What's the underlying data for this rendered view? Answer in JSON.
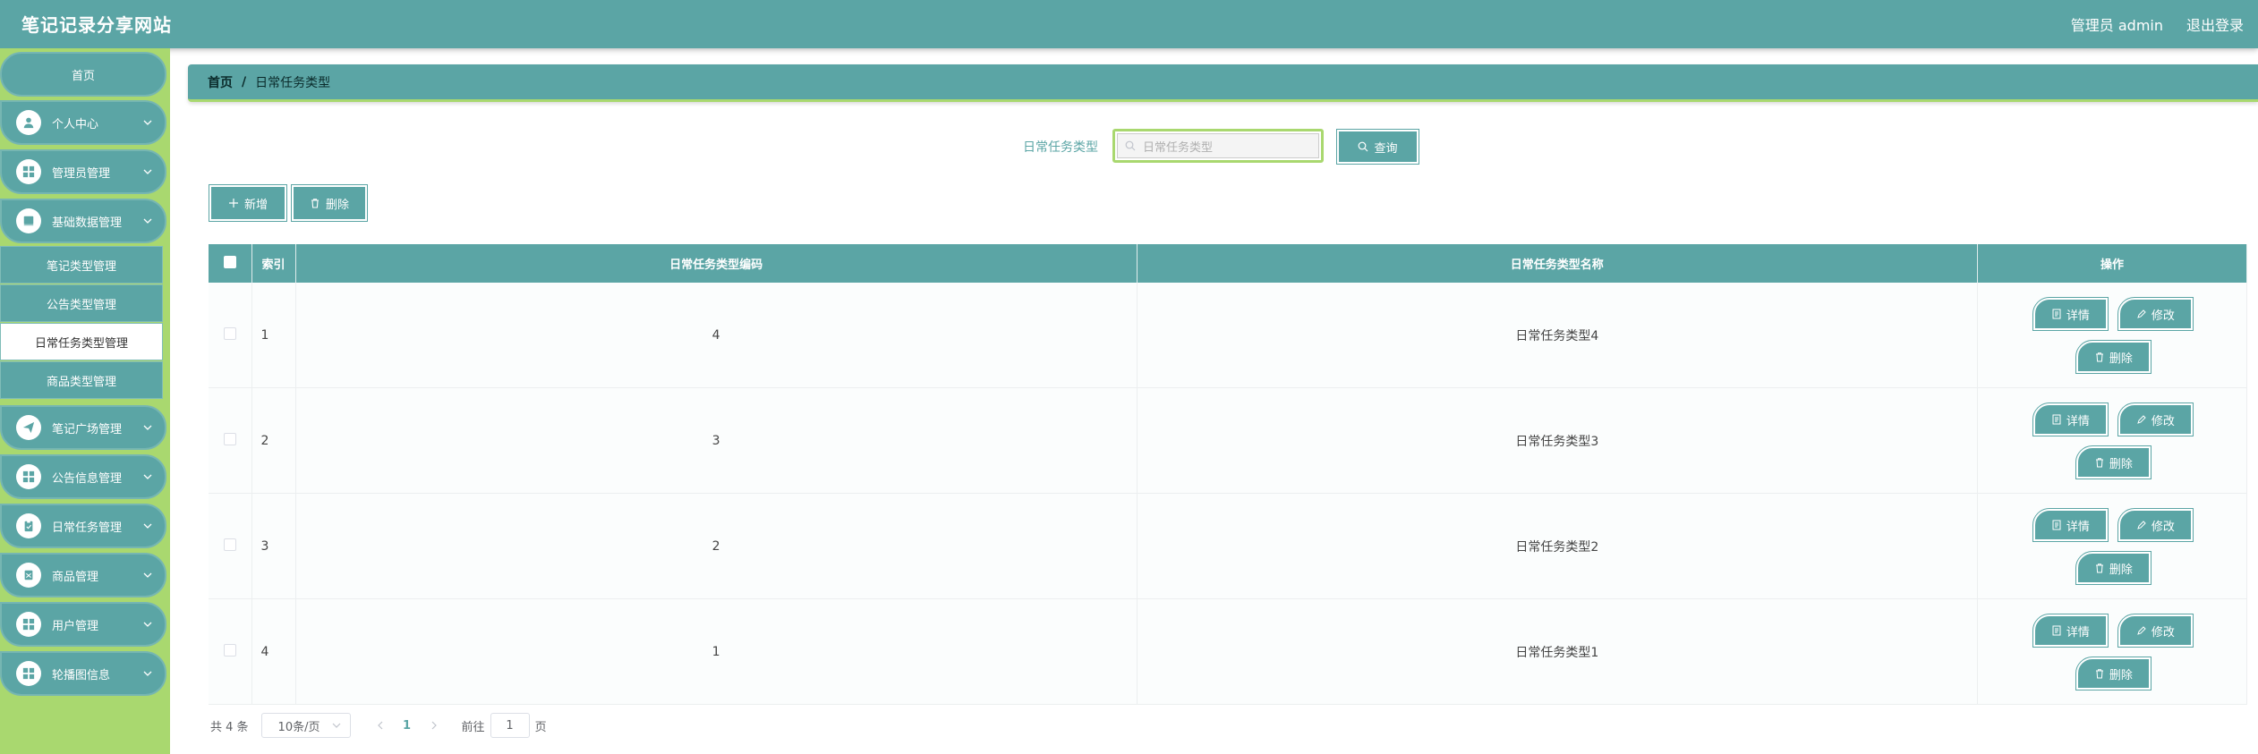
{
  "header": {
    "title": "笔记记录分享网站",
    "admin": "管理员 admin",
    "logout": "退出登录"
  },
  "sidebar": {
    "home": "首页",
    "items": [
      {
        "label": "个人中心",
        "icon": "user-icon"
      },
      {
        "label": "管理员管理",
        "icon": "grid-icon"
      },
      {
        "label": "基础数据管理",
        "icon": "book-icon"
      }
    ],
    "submenu": [
      {
        "label": "笔记类型管理"
      },
      {
        "label": "公告类型管理"
      },
      {
        "label": "日常任务类型管理"
      },
      {
        "label": "商品类型管理"
      }
    ],
    "items_after": [
      {
        "label": "笔记广场管理",
        "icon": "send-icon"
      },
      {
        "label": "公告信息管理",
        "icon": "grid-icon"
      },
      {
        "label": "日常任务管理",
        "icon": "clipboard-icon"
      },
      {
        "label": "商品管理",
        "icon": "tag-icon"
      },
      {
        "label": "用户管理",
        "icon": "grid-icon"
      },
      {
        "label": "轮播图信息",
        "icon": "grid-icon"
      }
    ]
  },
  "breadcrumb": {
    "home": "首页",
    "separator": "/",
    "current": "日常任务类型"
  },
  "search": {
    "label": "日常任务类型",
    "placeholder": "日常任务类型",
    "query_label": "查询"
  },
  "actions": {
    "add_label": "新增",
    "delete_label": "删除"
  },
  "table": {
    "headers": [
      "索引",
      "日常任务类型编码",
      "日常任务类型名称",
      "操作"
    ],
    "rows": [
      {
        "index": "1",
        "code": "4",
        "name": "日常任务类型4"
      },
      {
        "index": "2",
        "code": "3",
        "name": "日常任务类型3"
      },
      {
        "index": "3",
        "code": "2",
        "name": "日常任务类型2"
      },
      {
        "index": "4",
        "code": "1",
        "name": "日常任务类型1"
      }
    ],
    "op_detail": "详情",
    "op_edit": "修改",
    "op_delete": "删除"
  },
  "pagination": {
    "total": "共 4 条",
    "page_size": "10条/页",
    "current_page": "1",
    "jump_label": "前往",
    "jump_value": "1",
    "page_unit": "页"
  },
  "colors": {
    "primary": "#5ba5a5",
    "accent": "#a9d86f"
  }
}
